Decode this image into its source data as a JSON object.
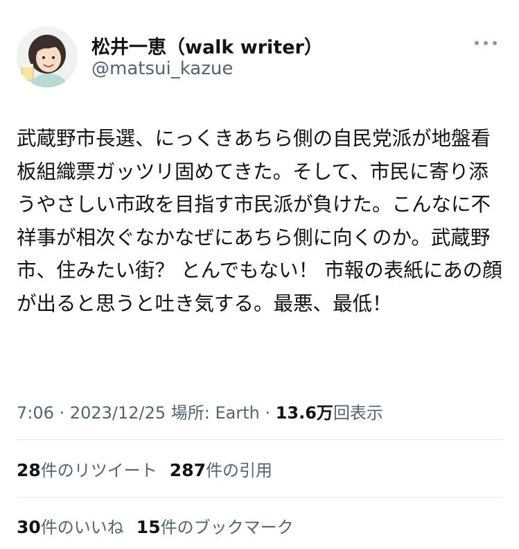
{
  "author": {
    "display_name": "松井一恵（walk writer）",
    "handle": "@matsui_kazue"
  },
  "tweet_text": "武蔵野市長選、にっくきあちら側の自民党派が地盤看板組織票ガッツリ固めてきた。そして、市民に寄り添うやさしい市政を目指す市民派が負けた。こんなに不祥事が相次ぐなかなぜにあちら側に向くのか。武蔵野市、住みたい街？ とんでもない！ 市報の表紙にあの顔が出ると思うと吐き気する。最悪、最低！",
  "meta": {
    "time": "7:06",
    "sep1": " · ",
    "date": "2023/12/25",
    "place_label": " 場所: Earth",
    "sep2": " · ",
    "views_count": "13.6万",
    "views_label": "回表示"
  },
  "stats": {
    "retweets_count": "28",
    "retweets_label": "件のリツイート",
    "quotes_count": "287",
    "quotes_label": "件の引用",
    "likes_count": "30",
    "likes_label": "件のいいね",
    "bookmarks_count": "15",
    "bookmarks_label": "件のブックマーク"
  },
  "icons": {
    "more": "more-horizontal-icon",
    "avatar": "avatar-illustration"
  },
  "colors": {
    "primary_text": "#0f1419",
    "secondary_text": "#536471",
    "divider": "#e4e7eb"
  }
}
